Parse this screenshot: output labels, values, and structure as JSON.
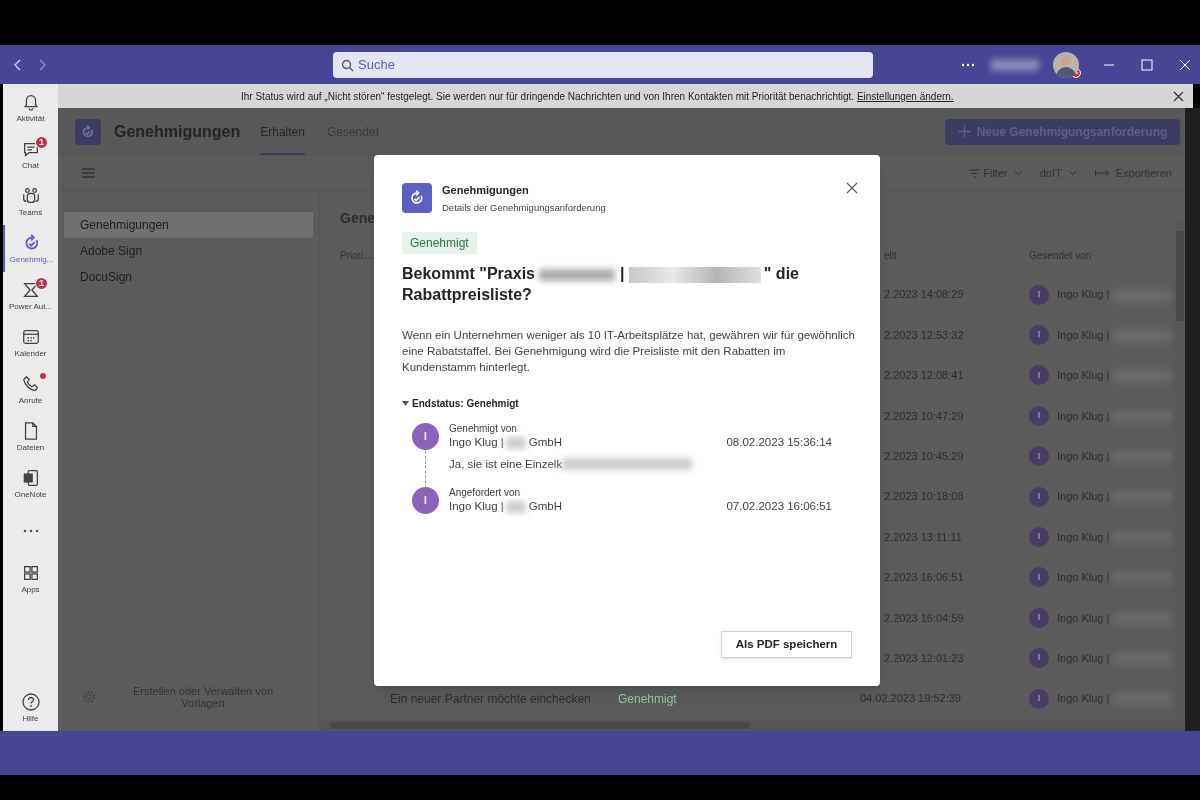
{
  "title_bar": {
    "search": {
      "placeholder": "Suche"
    }
  },
  "notice": {
    "text": "Ihr Status wird auf „Nicht stören“ festgelegt. Sie werden nur für dringende Nachrichten und von Ihren Kontakten mit Priorität benachrichtigt.",
    "link": "Einstellungen ändern."
  },
  "rail": [
    {
      "kind": "bell",
      "label": "Aktivität",
      "selected": false,
      "dot": false
    },
    {
      "kind": "chat",
      "label": "Chat",
      "selected": false,
      "badge": "1",
      "dot": false
    },
    {
      "kind": "teams",
      "label": "Teams",
      "selected": false,
      "dot": false
    },
    {
      "kind": "approvals",
      "label": "Genehmig...",
      "selected": true,
      "dot": false
    },
    {
      "kind": "flow",
      "label": "Power Aut...",
      "selected": false,
      "badge": "1",
      "dot": false
    },
    {
      "kind": "calendar",
      "label": "Kalender",
      "selected": false,
      "dot": false
    },
    {
      "kind": "phone",
      "label": "Anrufe",
      "selected": false,
      "dot": true
    },
    {
      "kind": "file",
      "label": "Dateien",
      "selected": false,
      "dot": false
    },
    {
      "kind": "onenote",
      "label": "OneNote",
      "selected": false,
      "dot": false
    },
    {
      "kind": "more"
    },
    {
      "kind": "apps",
      "label": "Apps",
      "selected": false,
      "dot": false
    }
  ],
  "help": {
    "label": "Hilfe"
  },
  "app_header": {
    "title": "Genehmigungen",
    "tabs": [
      {
        "label": "Erhalten",
        "selected": true
      },
      {
        "label": "Gesendet",
        "selected": false
      }
    ],
    "new_button": "Neue Genehmigungsanforderung"
  },
  "toolbar": {
    "filter": "Filter",
    "scope": "doIT",
    "export": "Exportieren"
  },
  "sidebar": {
    "items": [
      {
        "label": "Genehmigungen",
        "selected": true
      },
      {
        "label": "Adobe Sign",
        "selected": false
      },
      {
        "label": "DocuSign",
        "selected": false
      }
    ],
    "footer": "Erstellen oder Verwalten von Vorlagen"
  },
  "table": {
    "title": "Gene",
    "columns": {
      "column_1": "Priori…",
      "column_3": "ellt",
      "column_4": "Gesendet von"
    },
    "rows": [
      {
        "created": "2.2023 14:08:29",
        "sender": "Ingo Klug |",
        "avatar": "I"
      },
      {
        "created": "2.2023 12:53:32",
        "sender": "Ingo Klug |",
        "avatar": "I"
      },
      {
        "created": "2.2023 12:08:41",
        "sender": "Ingo Klug |",
        "avatar": "I"
      },
      {
        "created": "2.2023 10:47:29",
        "sender": "Ingo Klug |",
        "avatar": "I"
      },
      {
        "created": "2.2023 10:45:29",
        "sender": "Ingo Klug |",
        "avatar": "I"
      },
      {
        "created": "2.2023 10:18:08",
        "sender": "Ingo Klug |",
        "avatar": "I"
      },
      {
        "created": "2.2023 13:11:11",
        "sender": "Ingo Klug |",
        "avatar": "I"
      },
      {
        "created": "2.2023 16:06:51",
        "sender": "Ingo Klug |",
        "avatar": "I"
      },
      {
        "created": "2.2023 16:04:59",
        "sender": "Ingo Klug |",
        "avatar": "I"
      },
      {
        "created": "2.2023 12:01:23",
        "sender": "Ingo Klug |",
        "avatar": "I"
      },
      {
        "title": "Ein neuer Partner möchte einchecken",
        "status": "Genehmigt",
        "created": "04.02.2023 19:52:39",
        "sender": "Ingo Klug |",
        "avatar": "I"
      }
    ]
  },
  "dialog": {
    "app": "Genehmigungen",
    "subtitle": "Details der Genehmigungsanforderung",
    "status": "Genehmigt",
    "title": {
      "start": "Bekommt \"Praxis",
      "separator": "|",
      "end": "\" die",
      "line_2": "Rabattpreisliste?"
    },
    "description": "Wenn ein Unternehmen weniger als 10 IT-Arbeitsplätze hat, gewähren wir für gewöhnlich eine Rabatstaffel. Bei Genehmigung wird die Preisliste mit den Rabatten im Kundenstamm hinterlegt.",
    "final_status": {
      "label": "Endstatus: Genehmigt",
      "expanded": true
    },
    "timeline": [
      {
        "role": "Genehmigt von",
        "avatar": "I",
        "name": "Ingo Klug |",
        "company": "GmbH",
        "time": "08.02.2023 15:36:14",
        "comment": "Ja, sie ist eine Einzelk"
      },
      {
        "role": "Angefordert von",
        "avatar": "I",
        "name": "Ingo Klug |",
        "company": "GmbH",
        "time": "07.02.2023 16:06:51"
      }
    ],
    "save_button": "Als PDF speichern"
  }
}
